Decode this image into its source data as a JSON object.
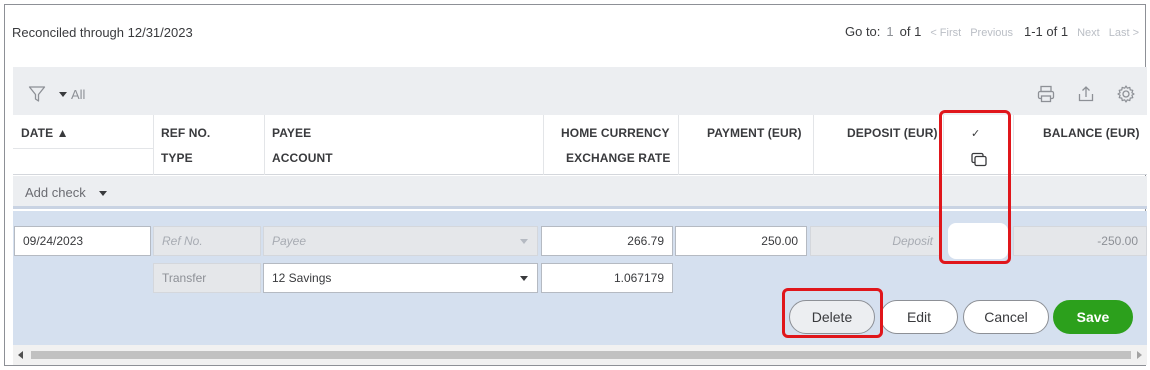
{
  "reconcile": {
    "status_text": "Reconciled through 12/31/2023"
  },
  "pager": {
    "goto_label": "Go to:",
    "current_page": "1",
    "of_pages": "of 1",
    "first": "< First",
    "previous": "Previous",
    "range": "1-1 of 1",
    "next": "Next",
    "last": "Last >"
  },
  "toolbar": {
    "filter_value": "All",
    "icons": [
      "filter-icon",
      "print-icon",
      "export-icon",
      "settings-icon"
    ]
  },
  "columns": {
    "date": "DATE ▲",
    "ref_no": "REF NO.",
    "type": "TYPE",
    "payee": "PAYEE",
    "account": "ACCOUNT",
    "home_currency": "HOME CURRENCY",
    "exchange_rate": "EXCHANGE RATE",
    "payment": "PAYMENT (EUR)",
    "deposit": "DEPOSIT (EUR)",
    "reconcile_check": "✓",
    "balance": "BALANCE (EUR)"
  },
  "add_check": {
    "label": "Add check"
  },
  "edit_row": {
    "date": "09/24/2023",
    "ref_placeholder": "Ref No.",
    "payee_placeholder": "Payee",
    "home_currency_amount": "266.79",
    "payment": "250.00",
    "deposit_placeholder": "Deposit",
    "balance": "-250.00",
    "type": "Transfer",
    "account": "12 Savings",
    "exchange_rate": "1.067179"
  },
  "actions": {
    "delete": "Delete",
    "edit": "Edit",
    "cancel": "Cancel",
    "save": "Save"
  },
  "colors": {
    "accent_green": "#2ca01c",
    "highlight_red": "#e0161b",
    "edit_row_bg": "#d5e0ef"
  }
}
